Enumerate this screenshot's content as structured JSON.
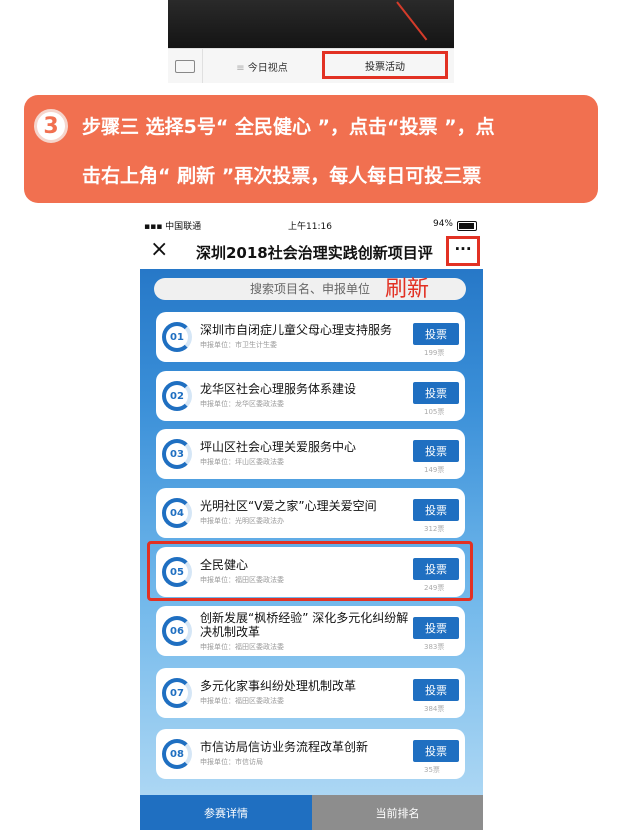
{
  "top_tabs": {
    "today": "今日视点",
    "vote": "投票活动"
  },
  "banner": {
    "step_number": "3",
    "line1": "步骤三  选择5号“ 全民健心 ”，点击“投票 ”，点",
    "line2": "击右上角“ 刷新 ”再次投票，每人每日可投三票"
  },
  "status_bar": {
    "carrier": "中国联通",
    "time": "上午11:16",
    "battery": "94%"
  },
  "nav": {
    "close": "×",
    "title": "深圳2018社会治理实践创新项目评",
    "more": "···"
  },
  "search": {
    "placeholder": "搜索项目名、申报单位"
  },
  "refresh_label": "刷新",
  "vote_label": "投票",
  "projects": [
    {
      "num": "01",
      "title": "深圳市自闭症儿童父母心理支持服务",
      "unit": "申报单位：市卫生计生委",
      "count": "199票"
    },
    {
      "num": "02",
      "title": "龙华区社会心理服务体系建设",
      "unit": "申报单位：龙华区委政法委",
      "count": "105票"
    },
    {
      "num": "03",
      "title": "坪山区社会心理关爱服务中心",
      "unit": "申报单位：坪山区委政法委",
      "count": "149票"
    },
    {
      "num": "04",
      "title": "光明社区“V爱之家”心理关爱空间",
      "unit": "申报单位：光明区委政法办",
      "count": "312票"
    },
    {
      "num": "05",
      "title": "全民健心",
      "unit": "申报单位：福田区委政法委",
      "count": "249票"
    },
    {
      "num": "06",
      "title": "创新发展“枫桥经验” 深化多元化纠纷解决机制改革",
      "unit": "申报单位：福田区委政法委",
      "count": "383票"
    },
    {
      "num": "07",
      "title": "多元化家事纠纷处理机制改革",
      "unit": "申报单位：福田区委政法委",
      "count": "384票"
    },
    {
      "num": "08",
      "title": "市信访局信访业务流程改革创新",
      "unit": "申报单位：市信访局",
      "count": "35票"
    }
  ],
  "bottom_tabs": {
    "details": "参赛详情",
    "ranking": "当前排名"
  },
  "colors": {
    "accent": "#1f6fc1",
    "highlight": "#e23123",
    "banner": "#f17050"
  }
}
